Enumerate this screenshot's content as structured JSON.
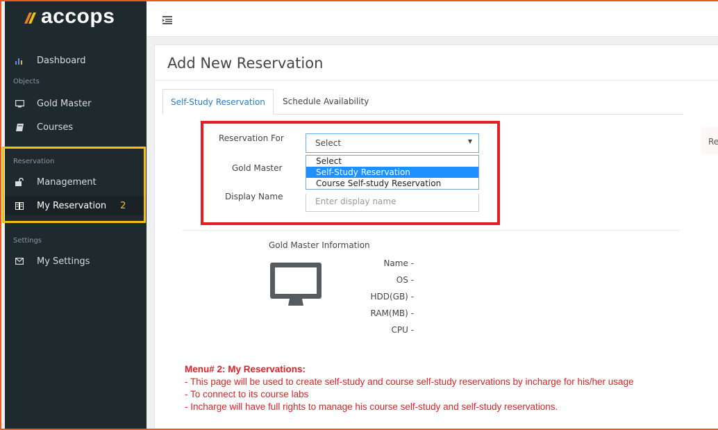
{
  "brand": {
    "name": "accops"
  },
  "sidebar": {
    "dashboard_label": "Dashboard",
    "sections": {
      "objects": "Objects",
      "reservation": "Reservation",
      "settings": "Settings"
    },
    "items": {
      "gold_master": "Gold Master",
      "courses": "Courses",
      "management": "Management",
      "my_reservation": "My Reservation",
      "my_settings": "My Settings"
    },
    "my_reservation_badge": "2"
  },
  "page": {
    "title": "Add New Reservation",
    "tabs": [
      "Self-Study Reservation",
      "Schedule Availability"
    ],
    "active_tab": "Self-Study Reservation"
  },
  "form": {
    "reservation_for_label": "Reservation For",
    "reservation_for_value": "Select",
    "reservation_for_options": [
      "Select",
      "Self-Study Reservation",
      "Course Self-study Reservation"
    ],
    "highlighted_option": "Self-Study Reservation",
    "gold_master_label": "Gold Master",
    "display_name_label": "Display Name",
    "display_name_placeholder": "Enter display name"
  },
  "gold_master_info": {
    "title": "Gold Master Information",
    "fields": [
      "Name -",
      "OS -",
      "HDD(GB) -",
      "RAM(MB) -",
      "CPU -"
    ]
  },
  "right_stub_text": "Re",
  "annotation": {
    "heading": "Menu# 2: My Reservations:",
    "lines": [
      "- This page will be used to create self-study and course self-study reservations by incharge for his/her usage",
      "- To connect to its course labs",
      "- Incharge will have full rights to manage his course self-study and self-study reservations."
    ]
  },
  "colors": {
    "sidebar_bg": "#1f2a2f",
    "highlight_yellow": "#f6c10c",
    "annotation_red": "#e31e24",
    "link_blue": "#2a7bbf",
    "dropdown_highlight": "#1e90ff"
  },
  "icons": [
    "bar-chart-icon",
    "monitor-icon",
    "book-icon",
    "unlock-icon",
    "book-open-icon",
    "envelope-icon",
    "menu-toggle-icon"
  ]
}
